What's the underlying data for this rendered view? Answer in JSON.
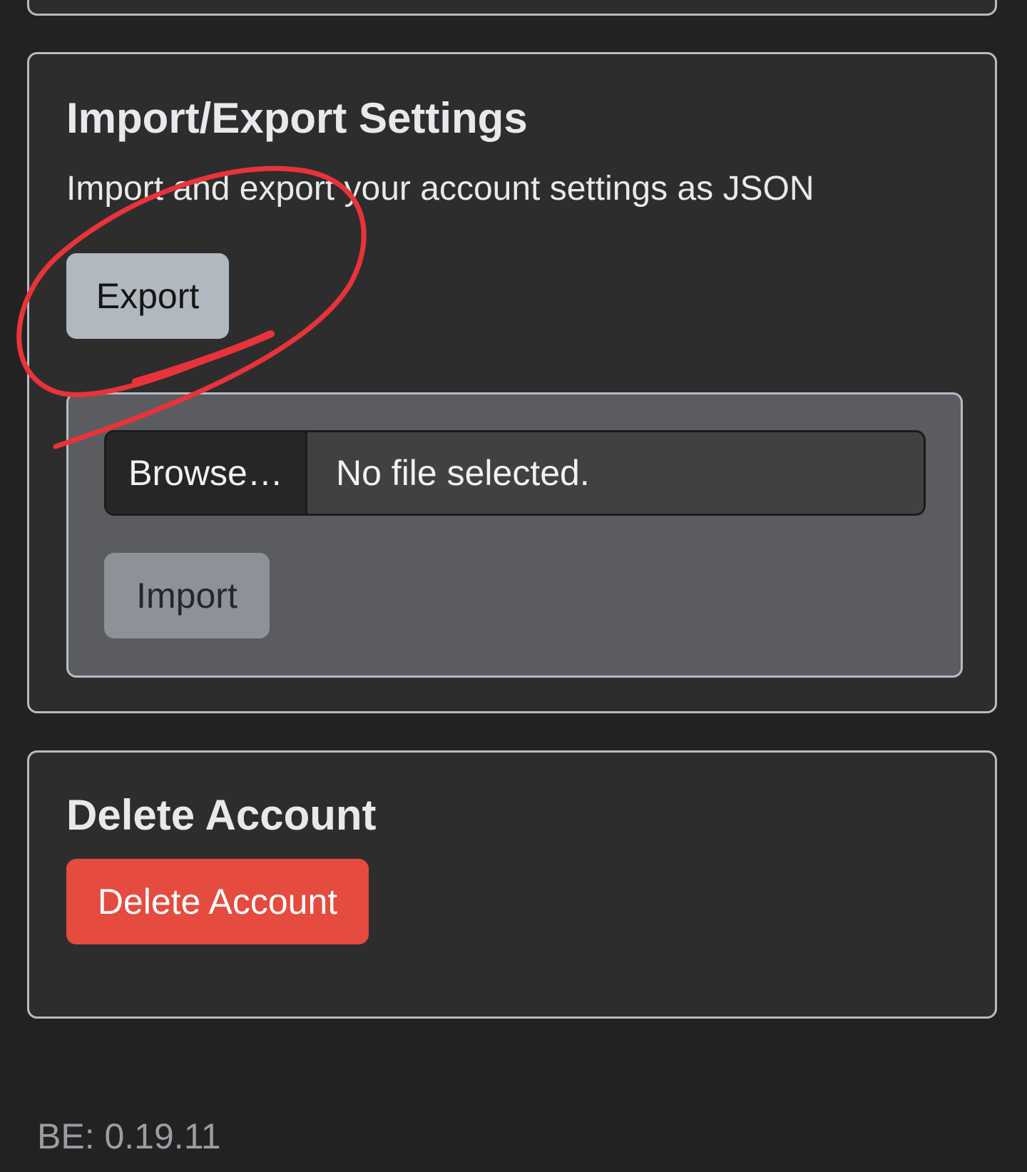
{
  "import_export": {
    "title": "Import/Export Settings",
    "description": "Import and export your account settings as JSON",
    "export_label": "Export",
    "browse_label": "Browse…",
    "file_status": "No file selected.",
    "import_label": "Import"
  },
  "delete_account": {
    "title": "Delete Account",
    "button_label": "Delete Account"
  },
  "footer": {
    "version": "BE: 0.19.11"
  },
  "colors": {
    "page_background": "#222222",
    "card_background": "#2d2d2d",
    "danger": "#e54b3f",
    "annotation": "#e8333a"
  }
}
